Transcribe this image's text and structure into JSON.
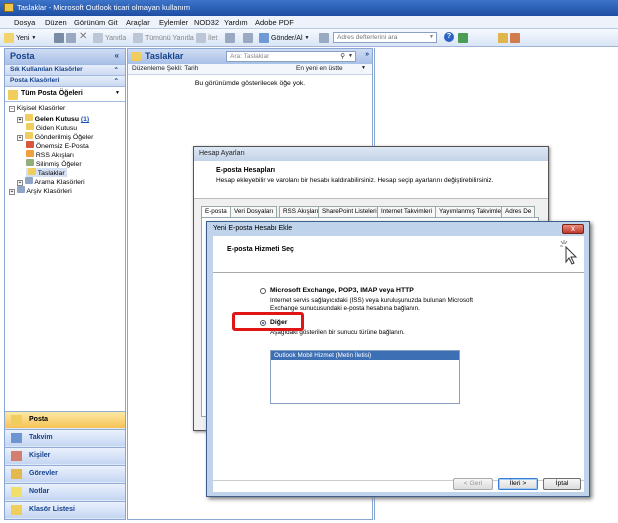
{
  "window": {
    "title": "Taslaklar - Microsoft Outlook ticari olmayan kullanım"
  },
  "menu": [
    "Dosya",
    "Düzen",
    "Görünüm",
    "Git",
    "Araçlar",
    "Eylemler",
    "NOD32",
    "Yardım",
    "Adobe PDF"
  ],
  "toolbar": {
    "new": "Yeni",
    "reply": "Yanıtla",
    "reply_all": "Tümünü Yanıtla",
    "forward": "İlet",
    "send_receive": "Gönder/Al",
    "address_placeholder": "Adres defterlerini ara"
  },
  "nav": {
    "title": "Posta",
    "fav_section": "Sık Kullanılan Klasörler",
    "mail_section": "Posta Klasörleri",
    "all_items": "Tüm Posta Öğeleri",
    "tree": [
      {
        "label": "Kişisel Klasörler"
      },
      {
        "label": "Gelen Kutusu",
        "count": "(1)"
      },
      {
        "label": "Giden Kutusu"
      },
      {
        "label": "Gönderilmiş Öğeler"
      },
      {
        "label": "Önemsiz E-Posta"
      },
      {
        "label": "RSS Akışları"
      },
      {
        "label": "Silinmiş Öğeler"
      },
      {
        "label": "Taslaklar"
      },
      {
        "label": "Arama Klasörleri"
      },
      {
        "label": "Arşiv Klasörleri"
      }
    ],
    "buttons": [
      "Posta",
      "Takvim",
      "Kişiler",
      "Görevler",
      "Notlar",
      "Klasör Listesi"
    ]
  },
  "content": {
    "title": "Taslaklar",
    "search_placeholder": "Ara: Taslaklar",
    "sort_label": "Düzenleme Şekli: Tarih",
    "sort_order": "En yeni en üstte",
    "empty": "Bu görünümde gösterilecek öğe yok."
  },
  "dialog1": {
    "title": "Hesap Ayarları",
    "heading": "E-posta Hesapları",
    "desc": "Hesap ekleyebilir ve varolanı bir hesabı kaldırabilirsiniz. Hesap seçip ayarlarını değiştirebilirsiniz.",
    "tabs": [
      "E-posta",
      "Veri Dosyaları",
      "RSS Akışları",
      "SharePoint Listeleri",
      "Internet Takvimleri",
      "Yayımlanmış Takvimler",
      "Adres De"
    ]
  },
  "dialog2": {
    "title": "Yeni E-posta Hesabı Ekle",
    "heading": "E-posta Hizmeti Seç",
    "opt1_label": "Microsoft Exchange, POP3, IMAP veya HTTP",
    "opt1_desc": "Internet servis sağlayıcıdaki (ISS) veya kuruluşunuzda bulunan Microsoft Exchange sunucusundaki e-posta hesabına bağlanın.",
    "opt2_label": "Diğer",
    "opt2_desc": "Aşağıdaki gösterilen bir sunucu türüne bağlanın.",
    "list_item": "Outlook Mobil Hizmet (Metin İletisi)",
    "back": "< Geri",
    "next": "İleri >",
    "cancel": "İptal",
    "close": "x"
  }
}
